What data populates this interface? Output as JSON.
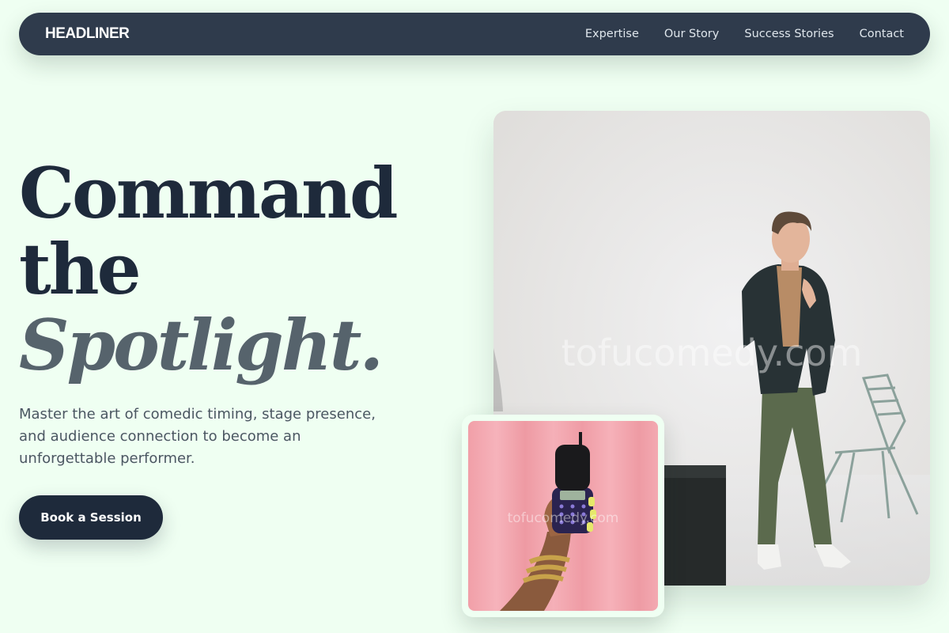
{
  "nav": {
    "brand": "HEADLINER",
    "links": [
      "Expertise",
      "Our Story",
      "Success Stories",
      "Contact"
    ]
  },
  "hero": {
    "headline_line1": "Command",
    "headline_line2": "the",
    "headline_accent": "Spotlight.",
    "subtext": "Master the art of comedic timing, stage presence, and audience connection to become an unforgettable performer.",
    "cta_label": "Book a Session"
  },
  "images": {
    "main_alt": "Comedian in a dark blazer posing beside a chair",
    "small_alt": "Hand holding a flip phone against a pink curtain",
    "watermark": "tofucomedy.com"
  },
  "colors": {
    "background": "#effff2",
    "nav_bg": "#2f3b4c",
    "headline": "#1e2a3b",
    "accent": "#56636c",
    "button_bg": "#1e2a3b"
  }
}
